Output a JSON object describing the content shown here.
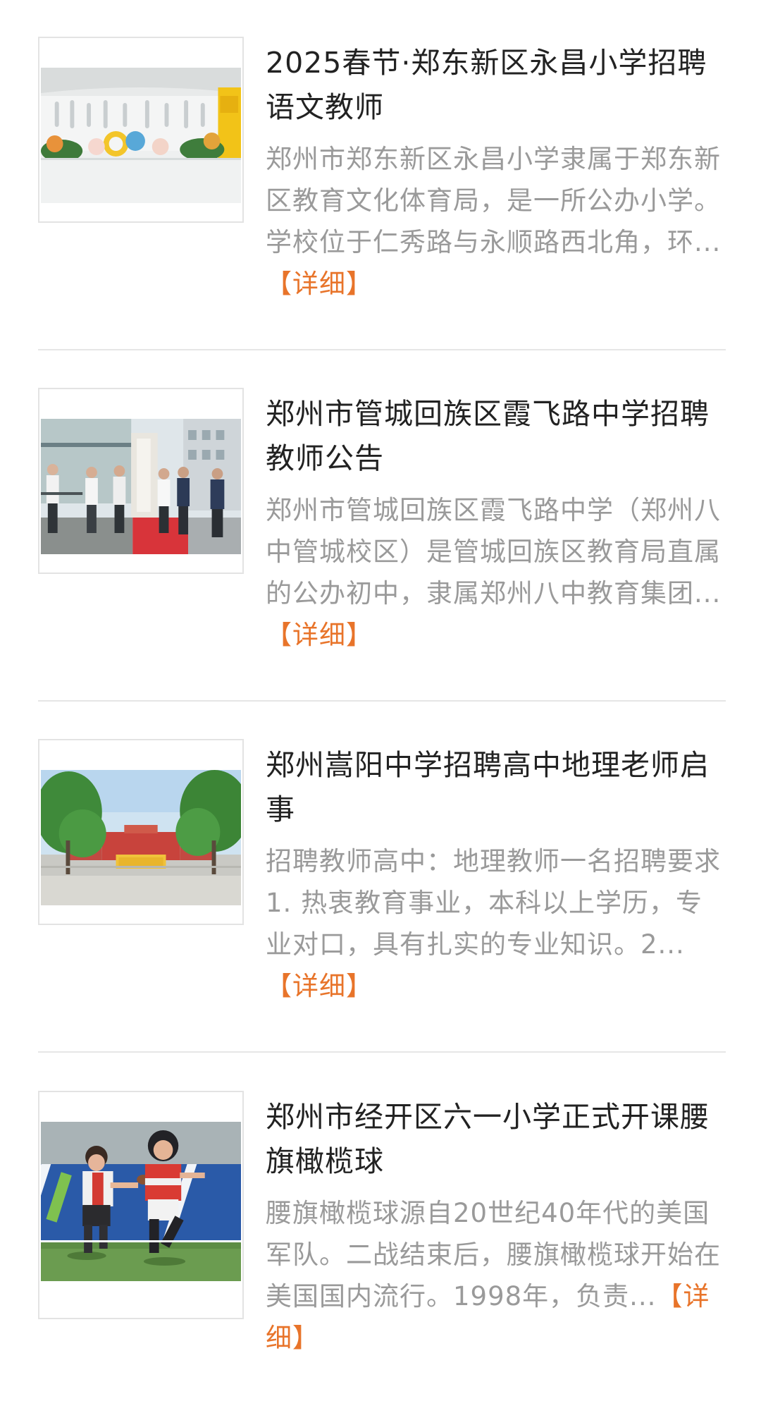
{
  "news": {
    "items": [
      {
        "title": "2025春节·郑东新区永昌小学招聘语文教师",
        "summary": "郑州市郑东新区永昌小学隶属于郑东新区教育文化体育局，是一所公办小学。学校位于仁秀路与永顺路西北角，环...",
        "detail_label": "【详细】",
        "thumb_icon": "school-lobby-photo"
      },
      {
        "title": "郑州市管城回族区霞飞路中学招聘教师公告",
        "summary": "郑州市管城回族区霞飞路中学（郑州八中管城校区）是管城回族区教育局直属的公办初中，隶属郑州八中教育集团...",
        "detail_label": "【详细】",
        "thumb_icon": "school-gate-ceremony-photo"
      },
      {
        "title": "郑州嵩阳中学招聘高中地理老师启事",
        "summary": "招聘教师高中：地理教师一名招聘要求1. 热衷教育事业，本科以上学历，专业对口，具有扎实的专业知识。2...",
        "detail_label": "【详细】",
        "thumb_icon": "school-campus-photo"
      },
      {
        "title": "郑州市经开区六一小学正式开课腰旗橄榄球",
        "summary": "腰旗橄榄球源自20世纪40年代的美国军队。二战结束后，腰旗橄榄球开始在美国国内流行。1998年，负责...",
        "detail_label": "【详细】",
        "thumb_icon": "flag-football-kids-photo"
      }
    ]
  }
}
